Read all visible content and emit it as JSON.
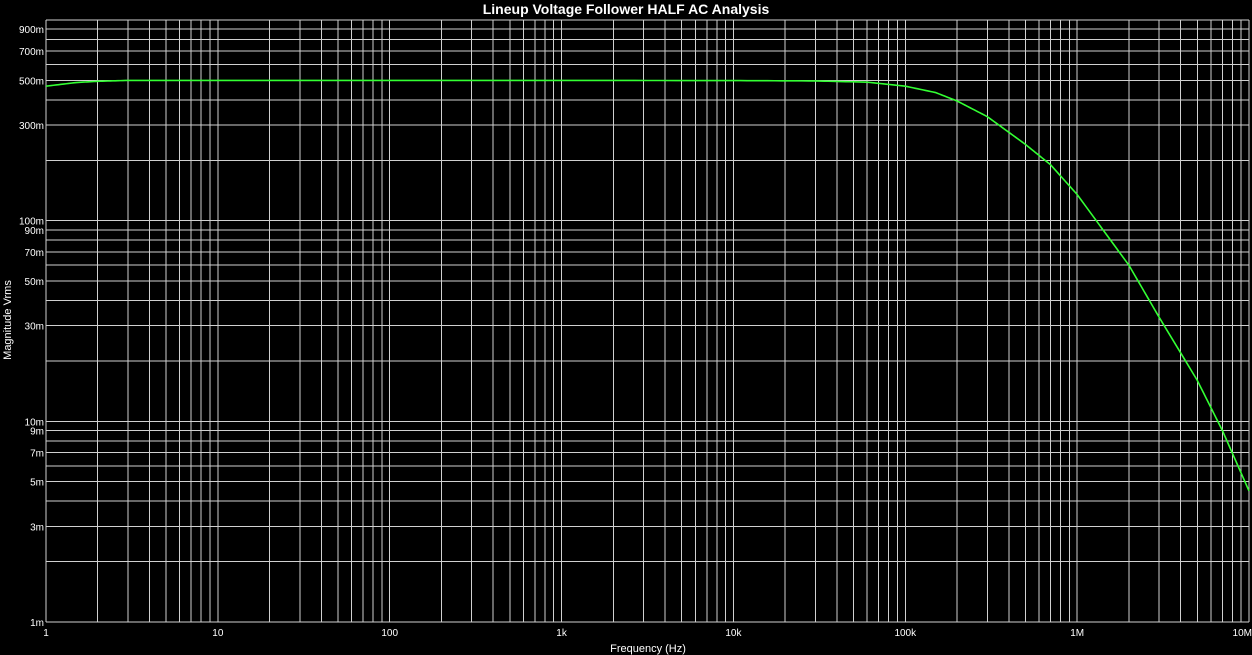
{
  "chart_data": {
    "type": "line",
    "title": "Lineup Voltage Follower HALF AC Analysis",
    "xlabel": "Frequency (Hz)",
    "ylabel": "Magnitude Vrms",
    "x_scale": "log",
    "y_scale": "log",
    "xlim": [
      1,
      10000000
    ],
    "ylim": [
      0.001,
      1
    ],
    "grid": true,
    "x_ticks": [
      {
        "value": 1,
        "label": "1"
      },
      {
        "value": 10,
        "label": "10"
      },
      {
        "value": 100,
        "label": "100"
      },
      {
        "value": 1000,
        "label": "1k"
      },
      {
        "value": 10000,
        "label": "10k"
      },
      {
        "value": 100000,
        "label": "100k"
      },
      {
        "value": 1000000,
        "label": "1M"
      },
      {
        "value": 10000000,
        "label": "10M"
      }
    ],
    "y_ticks": [
      {
        "value": 0.9,
        "label": "900m"
      },
      {
        "value": 0.7,
        "label": "700m"
      },
      {
        "value": 0.5,
        "label": "500m"
      },
      {
        "value": 0.3,
        "label": "300m"
      },
      {
        "value": 0.1,
        "label": "100m"
      },
      {
        "value": 0.09,
        "label": "90m"
      },
      {
        "value": 0.07,
        "label": "70m"
      },
      {
        "value": 0.05,
        "label": "50m"
      },
      {
        "value": 0.03,
        "label": "30m"
      },
      {
        "value": 0.01,
        "label": "10m"
      },
      {
        "value": 0.009,
        "label": "9m"
      },
      {
        "value": 0.007,
        "label": "7m"
      },
      {
        "value": 0.005,
        "label": "5m"
      },
      {
        "value": 0.003,
        "label": "3m"
      },
      {
        "value": 0.001,
        "label": "1m"
      }
    ],
    "series": [
      {
        "color": "#33ff33",
        "x": [
          1,
          1.5,
          2,
          3,
          10,
          100,
          1000,
          10000,
          30000,
          60000,
          100000,
          150000,
          200000,
          300000,
          500000,
          700000,
          1000000,
          2000000,
          3000000,
          5000000,
          7000000,
          10000000
        ],
        "y": [
          0.468,
          0.488,
          0.495,
          0.5,
          0.5,
          0.5,
          0.5,
          0.499,
          0.497,
          0.49,
          0.468,
          0.435,
          0.395,
          0.33,
          0.24,
          0.19,
          0.135,
          0.06,
          0.033,
          0.016,
          0.009,
          0.0045
        ]
      }
    ]
  }
}
